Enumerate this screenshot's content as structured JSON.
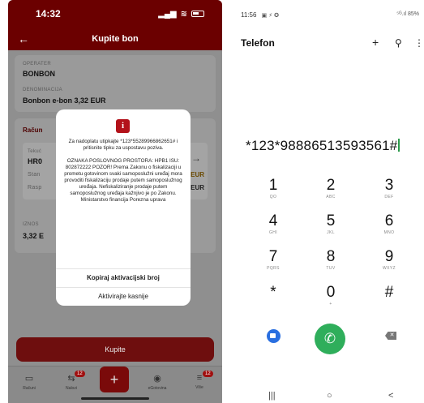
{
  "left": {
    "status": {
      "time": "14:32"
    },
    "header": {
      "back": "←",
      "title": "Kupite bon"
    },
    "operater": {
      "label": "OPERATER",
      "value": "BONBON"
    },
    "denominacija": {
      "label": "DENOMINACIJA",
      "value": "Bonbon e-bon 3,32 EUR"
    },
    "racun": {
      "title": "Račun",
      "row_label": "Tekuć",
      "account": "HR0",
      "stanje": "Stan",
      "raspolozivo": "Rasp",
      "eur1": "EUR",
      "eur2": "EUR",
      "arrow": "→"
    },
    "iznos": {
      "label": "IZNOS",
      "value": "3,32 E"
    },
    "buy_button": "Kupite",
    "tabs": [
      {
        "label": "Računi",
        "badge": ""
      },
      {
        "label": "Nalozi",
        "badge": "12"
      },
      {
        "label": "",
        "badge": ""
      },
      {
        "label": "eGotovina",
        "badge": ""
      },
      {
        "label": "Više",
        "badge": "12"
      }
    ],
    "fab": "+",
    "modal": {
      "icon": "i",
      "text1": "Za nadoplatu utipkajte *123*552899668626​51# i pritisnite tipku za uspostavu poziva.",
      "text2": "OZNAKA POSLOVNOG PROSTORA: HPB1 ISU: 802872222 POZOR! Prema Zakonu o fiskalizaciji u prometu gotovinom svaki samoposlužni uređaj mora provoditi fiskalizaciju prodaje putem samoposlužnog uređaja. Nefiskaliziranje prodaje putem samoposlužnog uređaja kažnjivo je po Zakonu. Ministarstvo financija Porezna uprava",
      "copy_button": "Kopiraj aktivacijski broj",
      "later_button": "Aktivirajte kasnije"
    }
  },
  "right": {
    "status": {
      "time": "11:56",
      "icons": "▣ ⚡ ✪",
      "signal": "⁵ᴳ.ıl 85%"
    },
    "title": "Telefon",
    "actions": {
      "add": "+",
      "search": "⚲",
      "more": "⋮"
    },
    "number": "*123*98886513593561#",
    "keys": [
      {
        "d": "1",
        "s": "QO"
      },
      {
        "d": "2",
        "s": "ABC"
      },
      {
        "d": "3",
        "s": "DEF"
      },
      {
        "d": "4",
        "s": "GHI"
      },
      {
        "d": "5",
        "s": "JKL"
      },
      {
        "d": "6",
        "s": "MNO"
      },
      {
        "d": "7",
        "s": "PQRS"
      },
      {
        "d": "8",
        "s": "TUV"
      },
      {
        "d": "9",
        "s": "WXYZ"
      },
      {
        "d": "*",
        "s": ""
      },
      {
        "d": "0",
        "s": "+"
      },
      {
        "d": "#",
        "s": ""
      }
    ],
    "call_icon": "✆",
    "delete_icon": "✕",
    "nav": {
      "recent": "|||",
      "home": "○",
      "back": "<"
    }
  }
}
